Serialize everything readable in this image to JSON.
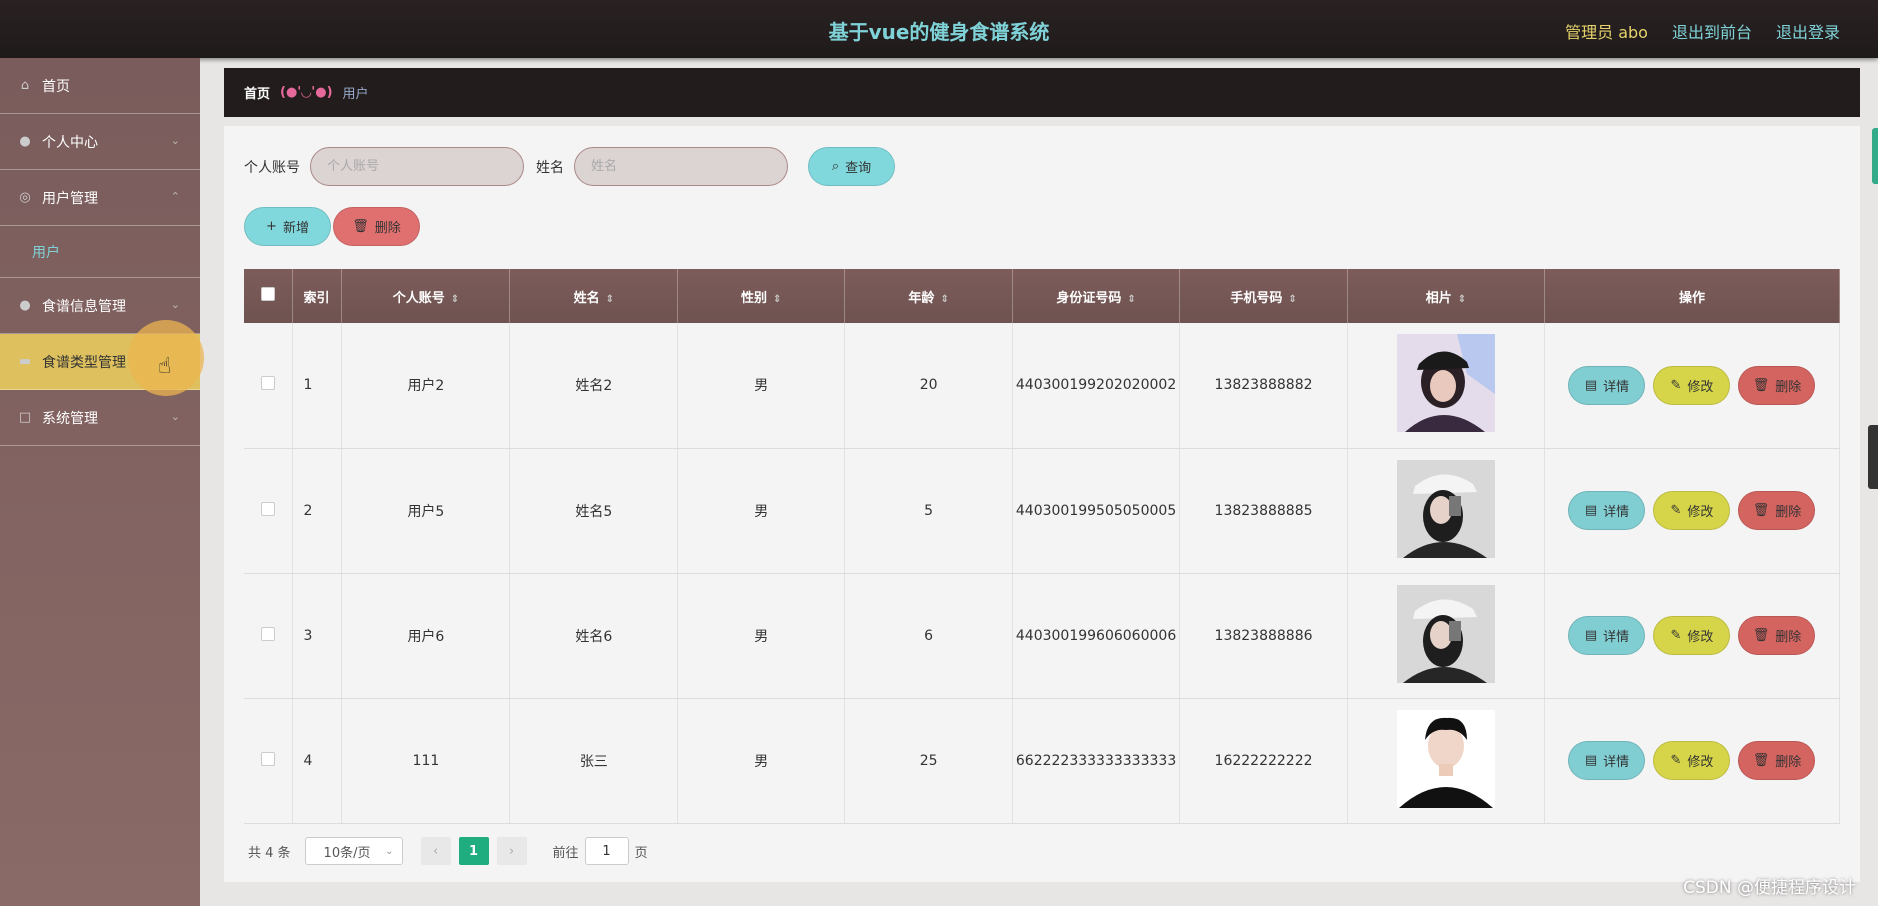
{
  "header": {
    "title": "基于vue的健身食谱系统",
    "user": "管理员 abo",
    "front_link": "退出到前台",
    "logout_link": "退出登录"
  },
  "sidebar": {
    "items": [
      {
        "label": "首页",
        "icon": "home-icon"
      },
      {
        "label": "个人中心",
        "icon": "person-icon"
      },
      {
        "label": "用户管理",
        "icon": "users-icon"
      },
      {
        "label": "用户",
        "sub": true
      },
      {
        "label": "食谱信息管理",
        "icon": "person-icon"
      },
      {
        "label": "食谱类型管理",
        "icon": "briefcase-icon"
      },
      {
        "label": "系统管理",
        "icon": "settings-icon"
      }
    ]
  },
  "breadcrumb": {
    "home": "首页",
    "separator": "(●'◡'●)",
    "current": "用户"
  },
  "search": {
    "account_label": "个人账号",
    "account_placeholder": "个人账号",
    "name_label": "姓名",
    "name_placeholder": "姓名",
    "query_label": "查询"
  },
  "actions": {
    "add_label": "新增",
    "delete_label": "删除"
  },
  "table": {
    "columns": [
      "索引",
      "个人账号",
      "姓名",
      "性别",
      "年龄",
      "身份证号码",
      "手机号码",
      "相片",
      "操作"
    ],
    "rows": [
      {
        "index": "1",
        "account": "用户2",
        "name": "姓名2",
        "gender": "男",
        "age": "20",
        "id_number": "440300199202020002",
        "phone": "13823888882"
      },
      {
        "index": "2",
        "account": "用户5",
        "name": "姓名5",
        "gender": "男",
        "age": "5",
        "id_number": "440300199505050005",
        "phone": "13823888885"
      },
      {
        "index": "3",
        "account": "用户6",
        "name": "姓名6",
        "gender": "男",
        "age": "6",
        "id_number": "440300199606060006",
        "phone": "13823888886"
      },
      {
        "index": "4",
        "account": "111",
        "name": "张三",
        "gender": "男",
        "age": "25",
        "id_number": "662222333333333333",
        "phone": "16222222222"
      }
    ],
    "row_actions": {
      "detail": "详情",
      "edit": "修改",
      "remove": "删除"
    }
  },
  "pagination": {
    "total": "共 4 条",
    "page_size": "10条/页",
    "current_page": "1",
    "goto_label": "前往",
    "goto_value": "1",
    "page_suffix": "页"
  },
  "watermark": "CSDN @便捷程序设计",
  "colors": {
    "accent": "#80d8dc",
    "sidebar_active": "#dec15e",
    "danger": "#d46460",
    "edit": "#d6d54a",
    "pager_active": "#1fad80"
  }
}
